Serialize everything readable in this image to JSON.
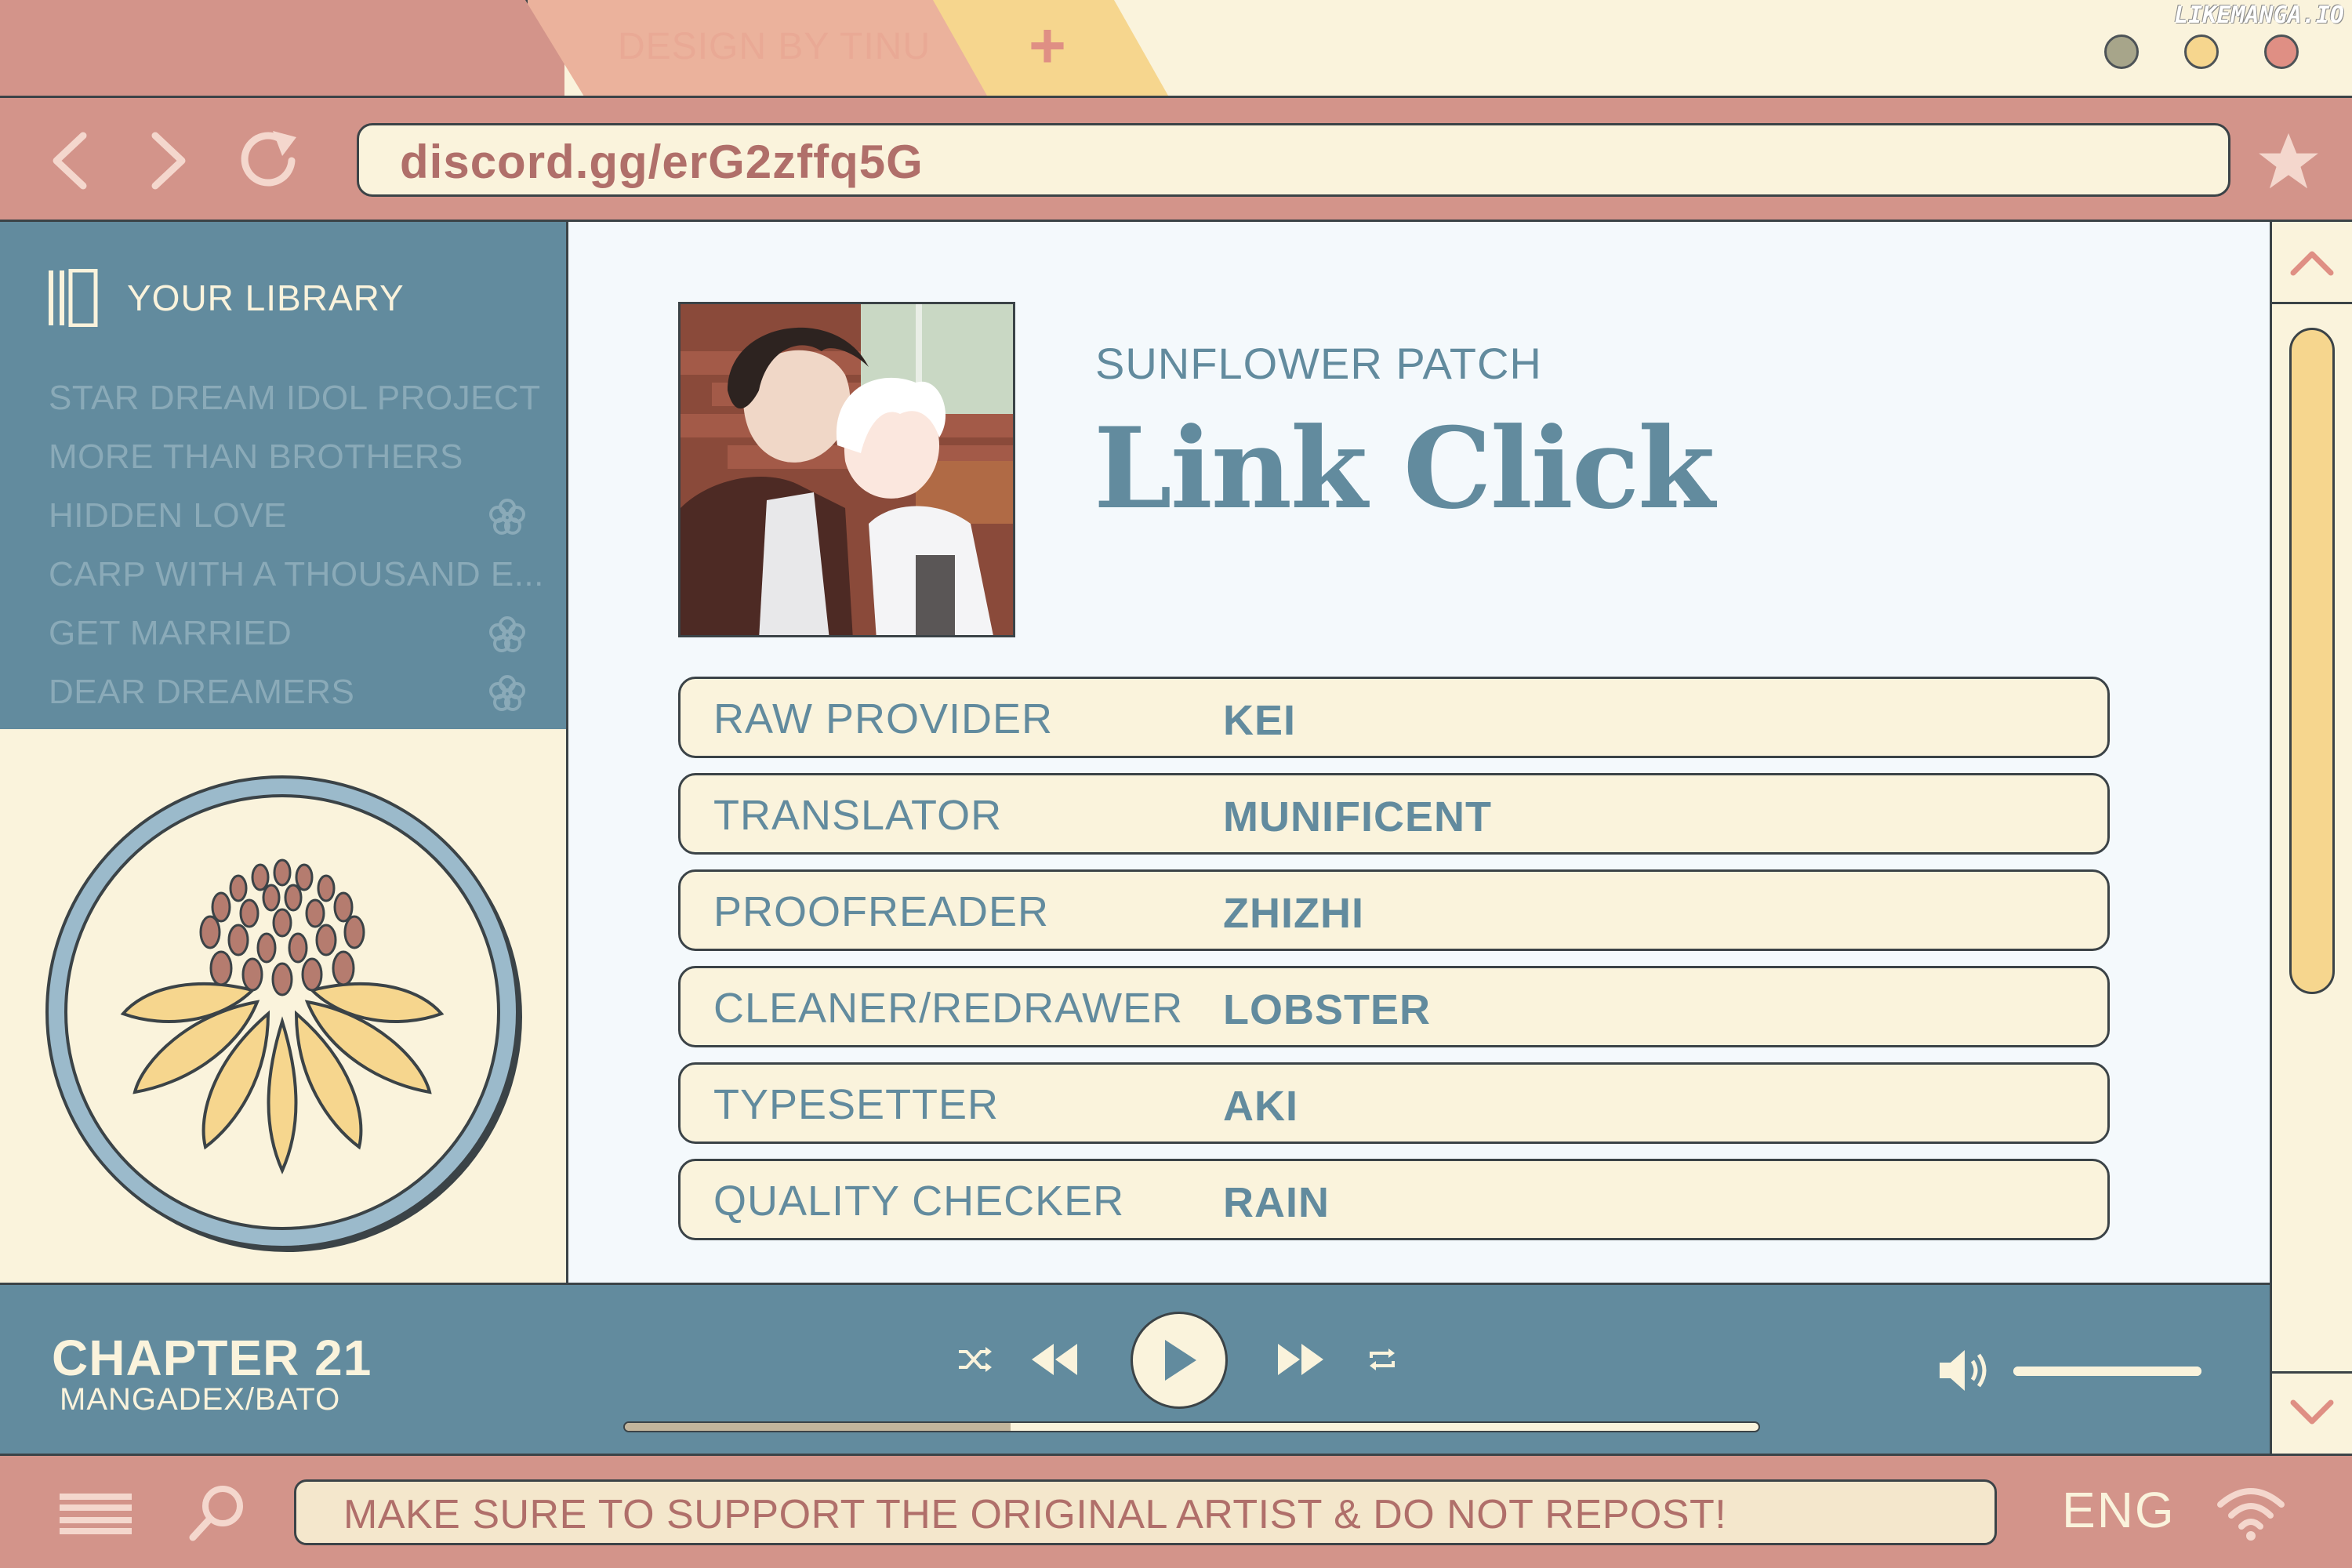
{
  "window": {
    "tabs": [
      {
        "label": "DESIGN BY TINU"
      },
      {
        "label": "+"
      }
    ],
    "watermark": "LIKEMANGA.IO",
    "dot_colors": [
      "#a7a58a",
      "#f6d68e",
      "#df8f84"
    ]
  },
  "address_bar": {
    "url": "discord.gg/erG2zffq5G"
  },
  "sidebar": {
    "library_title": "YOUR LIBRARY",
    "items": [
      {
        "label": "STAR DREAM IDOL PROJECT",
        "icon": ""
      },
      {
        "label": "MORE THAN BROTHERS",
        "icon": ""
      },
      {
        "label": "HIDDEN LOVE",
        "icon": "flower-icon"
      },
      {
        "label": "CARP WITH A THOUSAND E...",
        "icon": ""
      },
      {
        "label": "GET MARRIED",
        "icon": "flower-icon"
      },
      {
        "label": "DEAR DREAMERS",
        "icon": "flower-icon"
      }
    ]
  },
  "main": {
    "group": "SUNFLOWER PATCH",
    "title": "Link Click",
    "credits": [
      {
        "role": "RAW PROVIDER",
        "name": "KEI"
      },
      {
        "role": "TRANSLATOR",
        "name": "MUNIFICENT"
      },
      {
        "role": "PROOFREADER",
        "name": "ZHIZHI"
      },
      {
        "role": "CLEANER/REDRAWER",
        "name": "LOBSTER"
      },
      {
        "role": "TYPESETTER",
        "name": "AKI"
      },
      {
        "role": "QUALITY CHECKER",
        "name": "RAIN"
      }
    ]
  },
  "player": {
    "chapter": "CHAPTER 21",
    "source": "MANGADEX/BATO",
    "progress": 0.34,
    "volume": 1.0
  },
  "status_bar": {
    "notice": "MAKE SURE TO SUPPORT THE ORIGINAL ARTIST & DO NOT REPOST!",
    "language": "ENG"
  },
  "colors": {
    "rose": "#d3948a",
    "cream": "#faf3dc",
    "teal": "#628b9e",
    "yellow": "#f6d68e",
    "outline": "#3b4347"
  }
}
